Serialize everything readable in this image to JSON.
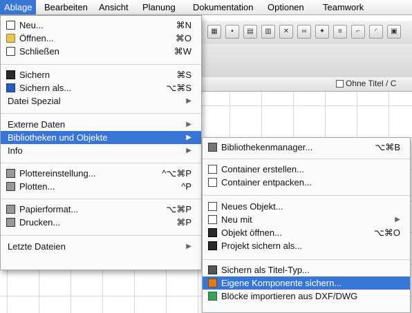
{
  "menubar": {
    "items": [
      "Ablage",
      "Bearbeiten",
      "Ansicht",
      "Planung",
      "Dokumentation",
      "Optionen",
      "Teamwork"
    ]
  },
  "window": {
    "title": "Ohne Titel / C"
  },
  "file_menu": {
    "items": [
      {
        "label": "Neu...",
        "shortcut": "⌘N",
        "icon": "new-document-icon"
      },
      {
        "label": "Öffnen...",
        "shortcut": "⌘O",
        "icon": "open-folder-icon"
      },
      {
        "label": "Schließen",
        "shortcut": "⌘W",
        "icon": "close-document-icon"
      },
      {
        "label": "Sichern",
        "shortcut": "⌘S",
        "icon": "save-disk-icon"
      },
      {
        "label": "Sichern als...",
        "shortcut": "⌥⌘S",
        "icon": "save-as-disk-icon"
      },
      {
        "label": "Datei Spezial",
        "shortcut": ""
      },
      {
        "label": "Externe Daten",
        "shortcut": ""
      },
      {
        "label": "Bibliotheken und Objekte",
        "shortcut": ""
      },
      {
        "label": "Info",
        "shortcut": ""
      },
      {
        "label": "Plottereinstellung...",
        "shortcut": "^⌥⌘P",
        "icon": "plotter-setup-icon"
      },
      {
        "label": "Plotten...",
        "shortcut": "^P",
        "icon": "plotter-icon"
      },
      {
        "label": "Papierformat...",
        "shortcut": "⌥⌘P",
        "icon": "page-setup-icon"
      },
      {
        "label": "Drucken...",
        "shortcut": "⌘P",
        "icon": "printer-icon"
      },
      {
        "label": "Letzte Dateien",
        "shortcut": ""
      }
    ]
  },
  "submenu": {
    "items": [
      {
        "label": "Bibliothekenmanager...",
        "shortcut": "⌥⌘B",
        "icon": "library-manager-icon"
      },
      {
        "label": "Container erstellen...",
        "shortcut": "",
        "icon": "create-container-icon"
      },
      {
        "label": "Container entpacken...",
        "shortcut": "",
        "icon": "extract-container-icon"
      },
      {
        "label": "Neues Objekt...",
        "shortcut": "",
        "icon": "new-object-icon"
      },
      {
        "label": "Neu mit",
        "shortcut": "",
        "icon": "new-with-icon"
      },
      {
        "label": "Objekt öffnen...",
        "shortcut": "⌥⌘O",
        "icon": "open-object-icon"
      },
      {
        "label": "Projekt sichern als...",
        "shortcut": "",
        "icon": "save-project-icon"
      },
      {
        "label": "Sichern als Titel-Typ...",
        "shortcut": "",
        "icon": "save-title-type-icon"
      },
      {
        "label": "Eigene Komponente sichern...",
        "shortcut": "",
        "icon": "save-component-icon"
      },
      {
        "label": "Blöcke importieren aus DXF/DWG",
        "shortcut": "",
        "icon": "import-dxf-icon"
      }
    ]
  },
  "colors": {
    "highlight": "#3876d6"
  }
}
